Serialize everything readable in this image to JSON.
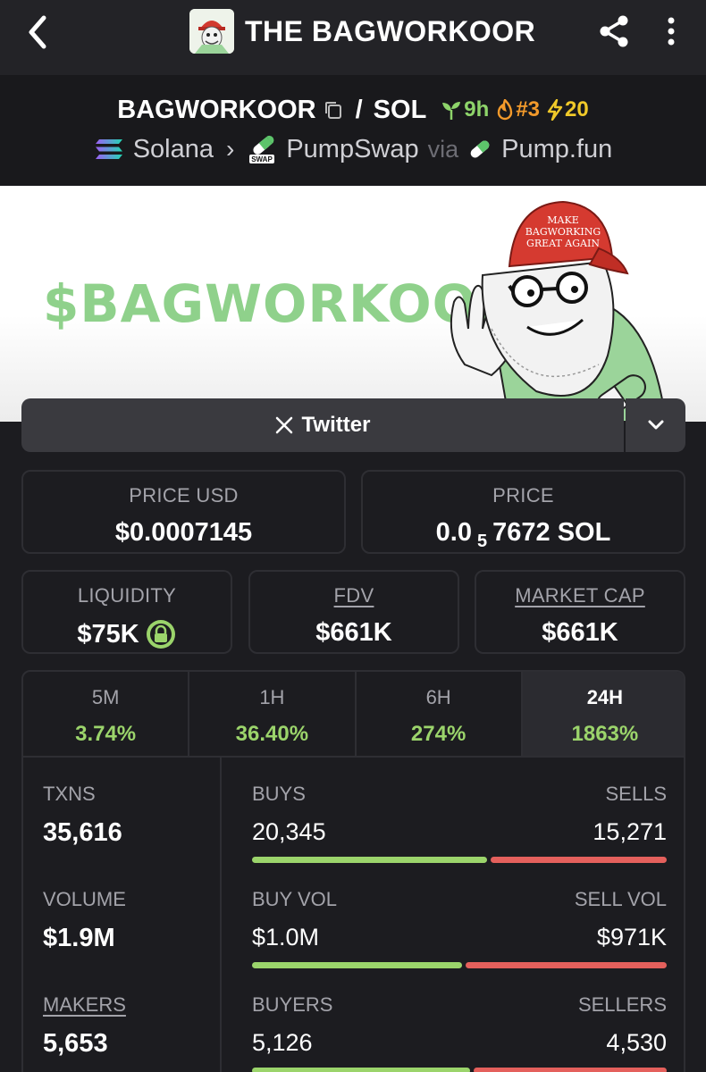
{
  "header": {
    "title": "THE BAGWORKOOR"
  },
  "pair": {
    "base": "BAGWORKOOR",
    "separator": "/",
    "quote": "SOL",
    "age": "9h",
    "rank": "#3",
    "boosts": "20"
  },
  "route": {
    "chain": "Solana",
    "dex": "PumpSwap",
    "dex_badge": "SWAP",
    "via": "via",
    "launchpad": "Pump.fun"
  },
  "banner": {
    "text": "$BAGWORKOOR",
    "hat_text": [
      "MAKE",
      "BAGWORKING",
      "GREAT AGAIN"
    ]
  },
  "socials": {
    "twitter_label": "Twitter"
  },
  "prices": {
    "price_usd_label": "PRICE USD",
    "price_usd": "$0.0007145",
    "price_label": "PRICE",
    "price_native_prefix": "0.0",
    "price_native_zeros": "5",
    "price_native_digits": "7672 SOL"
  },
  "metrics": {
    "liquidity_label": "LIQUIDITY",
    "liquidity": "$75K",
    "fdv_label": "FDV",
    "fdv": "$661K",
    "mcap_label": "MARKET CAP",
    "mcap": "$661K"
  },
  "timeframes": [
    {
      "label": "5M",
      "change": "3.74%",
      "active": false
    },
    {
      "label": "1H",
      "change": "36.40%",
      "active": false
    },
    {
      "label": "6H",
      "change": "274%",
      "active": false
    },
    {
      "label": "24H",
      "change": "1863%",
      "active": true
    }
  ],
  "stats": {
    "txns_label": "TXNS",
    "txns": "35,616",
    "volume_label": "VOLUME",
    "volume": "$1.9M",
    "makers_label": "MAKERS",
    "makers": "5,653",
    "buys_label": "BUYS",
    "buys": "20,345",
    "sells_label": "SELLS",
    "sells": "15,271",
    "buy_vol_label": "BUY VOL",
    "buy_vol": "$1.0M",
    "sell_vol_label": "SELL VOL",
    "sell_vol": "$971K",
    "buyers_label": "BUYERS",
    "buyers": "5,126",
    "sellers_label": "SELLERS",
    "sellers": "4,530"
  },
  "ratios": {
    "buys_share": 0.571,
    "buy_vol_share": 0.51,
    "buyers_share": 0.531
  },
  "colors": {
    "positive": "#9bd46b",
    "negative": "#e4605c",
    "brand_green": "#8fd18b"
  }
}
